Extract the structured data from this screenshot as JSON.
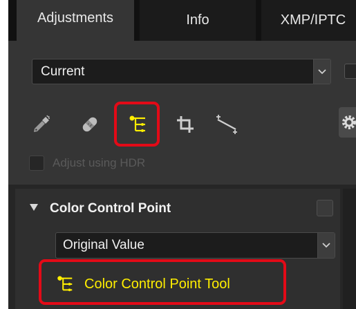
{
  "tabs": [
    {
      "label": "Adjustments",
      "active": true
    },
    {
      "label": "Info",
      "active": false
    },
    {
      "label": "XMP/IPTC",
      "active": false
    }
  ],
  "preset_select": {
    "value": "Current"
  },
  "toolbar": {
    "icons": [
      "eyedropper-icon",
      "retouch-brush-icon",
      "color-control-point-icon",
      "crop-icon",
      "straighten-icon",
      "gear-icon"
    ],
    "selected": "color-control-point-icon"
  },
  "hdr_checkbox": {
    "label": "Adjust using HDR",
    "checked": false,
    "enabled": false
  },
  "ccp_section": {
    "title": "Color Control Point",
    "expanded": true,
    "mode_select": {
      "value": "Original Value"
    },
    "tool_button": {
      "label": "Color Control Point Tool"
    }
  },
  "colors": {
    "panel": "#353535",
    "tab_bar": "#111111",
    "accent_yellow": "#ffee00",
    "highlight_red": "#e30a17"
  }
}
